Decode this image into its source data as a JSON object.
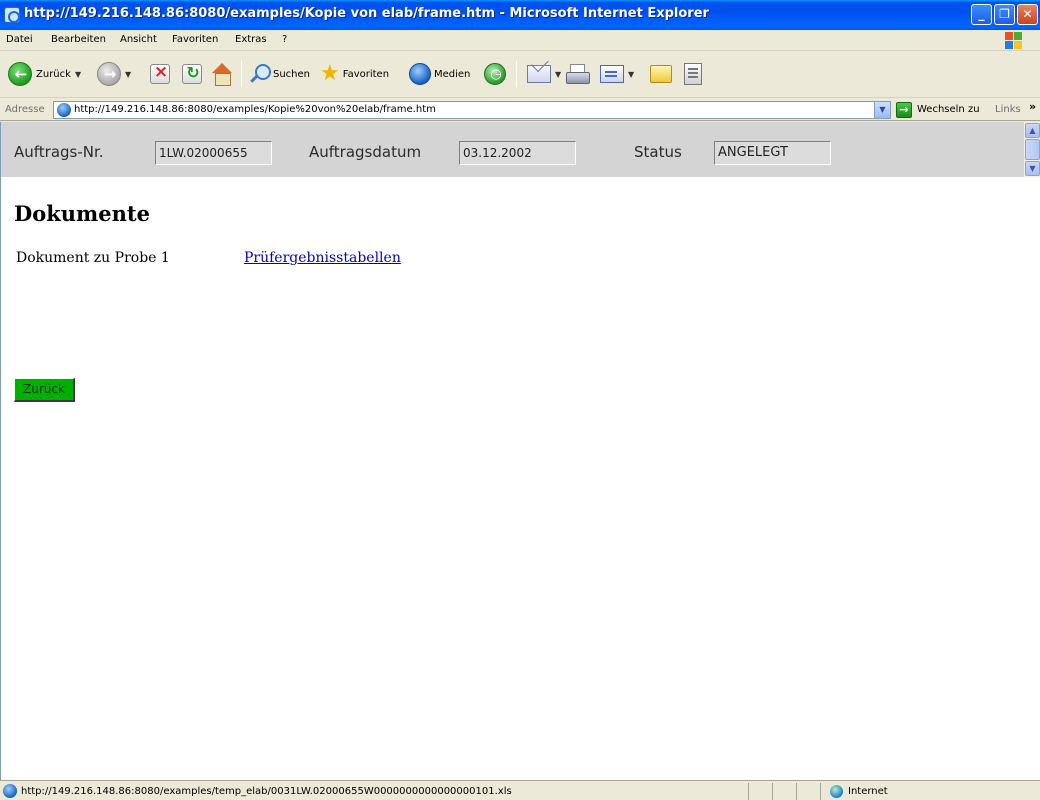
{
  "window": {
    "title": "http://149.216.148.86:8080/examples/Kopie von elab/frame.htm - Microsoft Internet Explorer",
    "minimize_glyph": "_",
    "maximize_glyph": "❐",
    "close_glyph": "✕"
  },
  "menu": {
    "items": [
      "Datei",
      "Bearbeiten",
      "Ansicht",
      "Favoriten",
      "Extras",
      "?"
    ]
  },
  "toolbar": {
    "back_label": "Zurück",
    "search_label": "Suchen",
    "favorites_label": "Favoriten",
    "media_label": "Medien"
  },
  "address": {
    "label": "Adresse",
    "url": "http://149.216.148.86:8080/examples/Kopie%20von%20elab/frame.htm",
    "go_label": "Wechseln zu",
    "links_label": "Links",
    "links_chevron": "»"
  },
  "header": {
    "order_no_label": "Auftrags-Nr.",
    "order_no_value": "1LW.02000655",
    "order_date_label": "Auftragsdatum",
    "order_date_value": "03.12.2002",
    "status_label": "Status",
    "status_value": "ANGELEGT"
  },
  "main": {
    "heading": "Dokumente",
    "documents": [
      {
        "label": "Dokument zu Probe 1",
        "link_text": "Prüfergebnisstabellen"
      }
    ],
    "back_button": "Zurück"
  },
  "statusbar": {
    "text": "http://149.216.148.86:8080/examples/temp_elab/0031LW.02000655W0000000000000000101.xls",
    "zone": "Internet"
  },
  "colors": {
    "title_bar": "#0054e3",
    "header_frame_bg": "#d4d4d4",
    "back_button_bg": "#00b000",
    "link": "#0000cc"
  },
  "icons": [
    "ie-page-icon",
    "back-arrow-icon",
    "forward-arrow-icon",
    "stop-icon",
    "refresh-icon",
    "home-icon",
    "search-icon",
    "favorites-star-icon",
    "media-icon",
    "history-icon",
    "mail-icon",
    "print-icon",
    "edit-icon",
    "folder-icon",
    "messenger-icon",
    "go-arrow-icon",
    "internet-zone-icon"
  ]
}
